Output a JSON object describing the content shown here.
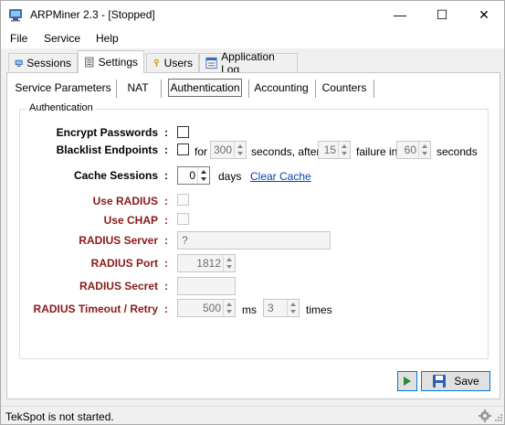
{
  "window": {
    "title": "ARPMiner 2.3 - [Stopped]",
    "minimize_glyph": "—",
    "maximize_glyph": "☐",
    "close_glyph": "✕"
  },
  "menu": {
    "items": [
      "File",
      "Service",
      "Help"
    ]
  },
  "main_tabs": {
    "items": [
      "Sessions",
      "Settings",
      "Users",
      "Application Log"
    ],
    "active": "Settings"
  },
  "sub_tabs": {
    "items": [
      "Service Parameters",
      "NAT",
      "Authentication",
      "Accounting",
      "Counters"
    ],
    "active": "Authentication"
  },
  "group": {
    "legend": "Authentication"
  },
  "form": {
    "encrypt_passwords_label": "Encrypt Passwords",
    "blacklist_label": "Blacklist Endpoints",
    "blacklist_for": "for",
    "blacklist_seconds_value": "300",
    "blacklist_seconds_after": "seconds, after",
    "blacklist_failures_value": "15",
    "blacklist_failure_in": "failure in",
    "blacklist_window_value": "60",
    "blacklist_seconds": "seconds",
    "cache_sessions_label": "Cache Sessions",
    "cache_sessions_value": "0",
    "cache_days": "days",
    "clear_cache_link": "Clear Cache",
    "use_radius_label": "Use RADIUS",
    "use_chap_label": "Use CHAP",
    "radius_server_label": "RADIUS Server",
    "radius_server_value": "?",
    "radius_port_label": "RADIUS Port",
    "radius_port_value": "1812",
    "radius_secret_label": "RADIUS Secret",
    "radius_secret_value": "",
    "radius_timeout_label": "RADIUS Timeout / Retry",
    "radius_timeout_value": "500",
    "radius_timeout_unit": "ms",
    "radius_retry_value": "3",
    "radius_retry_unit": "times",
    "colon": ":"
  },
  "buttons": {
    "save_label": "Save"
  },
  "status": {
    "text": "TekSpot is not started."
  },
  "colors": {
    "label_red": "#8b1a1a",
    "link_blue": "#0645ad",
    "focus_blue": "#0078d7"
  }
}
